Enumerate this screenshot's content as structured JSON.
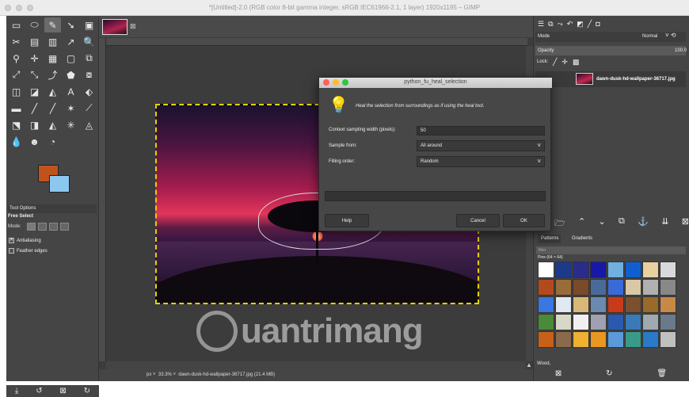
{
  "window": {
    "title": "*[Untitled]-2.0 (RGB color 8-bit gamma integer, sRGB IEC61966-2.1, 1 layer) 1920x1195 – GIMP"
  },
  "toolbox": {
    "tools": [
      "▭",
      "⬭",
      "✎",
      "➘",
      "▣",
      "✂",
      "▤",
      "▥",
      "↗",
      "🔍",
      "⚲",
      "✛",
      "▦",
      "▢",
      "⧉",
      "⤢",
      "⤡",
      "⤴",
      "⬟",
      "⧇",
      "◫",
      "◪",
      "◭",
      "A",
      "⬖",
      "▬",
      "╱",
      "╱",
      "✶",
      "⟋",
      "⬔",
      "◨",
      "◭",
      "✳",
      "◬",
      "💧",
      "☻",
      "◔"
    ],
    "selected_index": 2,
    "fg_color": "#c0531b",
    "bg_color": "#8cc7ee",
    "options_tab": "Tool Options",
    "options_title": "Free Select",
    "mode_label": "Mode:",
    "antialiasing_label": "Antialiasing",
    "feather_label": "Feather edges",
    "bottom_icons": [
      "⤓",
      "↺",
      "⊠",
      "↻"
    ]
  },
  "status": {
    "unit": "px",
    "zoom": "33.3%",
    "file": "dawn-dusk-hd-wallpaper-36717.jpg (21.4 MB)"
  },
  "watermark": {
    "text": "uantrimang"
  },
  "layers": {
    "mode_label": "Mode",
    "mode_value": "Normal",
    "opacity_label": "Opacity",
    "opacity_value": "100.0",
    "lock_label": "Lock:",
    "layer_name": "dawn-dusk-hd-wallpaper-36717.jpg",
    "tab_patterns": "Patterns",
    "tab_gradients": "Gradients",
    "filter_placeholder": "filter",
    "pattern_title": "Pine (64 × 64)",
    "pattern_bottom": "Wood,",
    "pattern_colors": [
      "#ffffff",
      "#1d3a8a",
      "#2b2b8c",
      "#1717a8",
      "#6fb0e0",
      "#0f5fd0",
      "#e8d0a0",
      "#d9d9d9",
      "#b34a1e",
      "#9a6c3a",
      "#7a4a2a",
      "#4a6a9a",
      "#3a6ad8",
      "#d8c8a8",
      "#b0b0b0",
      "#888888",
      "#3878e0",
      "#e0e8f0",
      "#d8b878",
      "#6a8ab0",
      "#c83a1a",
      "#7a5030",
      "#9a6a2a",
      "#c88848",
      "#4a8a3a",
      "#d8d8c8",
      "#f0f0f0",
      "#a0a0b0",
      "#2a5ab0",
      "#3a7ab8",
      "#a0a8b0",
      "#6a7a8a",
      "#c86018",
      "#8a6a4a",
      "#f0b030",
      "#e89820",
      "#5a9ad8",
      "#3a9a8a",
      "#2a7ac8",
      "#c0c0c0"
    ],
    "bottom_icons": [
      "⊠",
      "↻",
      "🗑"
    ]
  },
  "dialog": {
    "title": "python_fu_heal_selection",
    "description": "Heal the selection from surroundings as if using the heal tool.",
    "width_label": "Context sampling width (pixels):",
    "width_value": "50",
    "sample_label": "Sample from:",
    "sample_value": "All around",
    "order_label": "Filling order:",
    "order_value": "Random",
    "help_label": "Help",
    "cancel_label": "Cancel",
    "ok_label": "OK"
  }
}
